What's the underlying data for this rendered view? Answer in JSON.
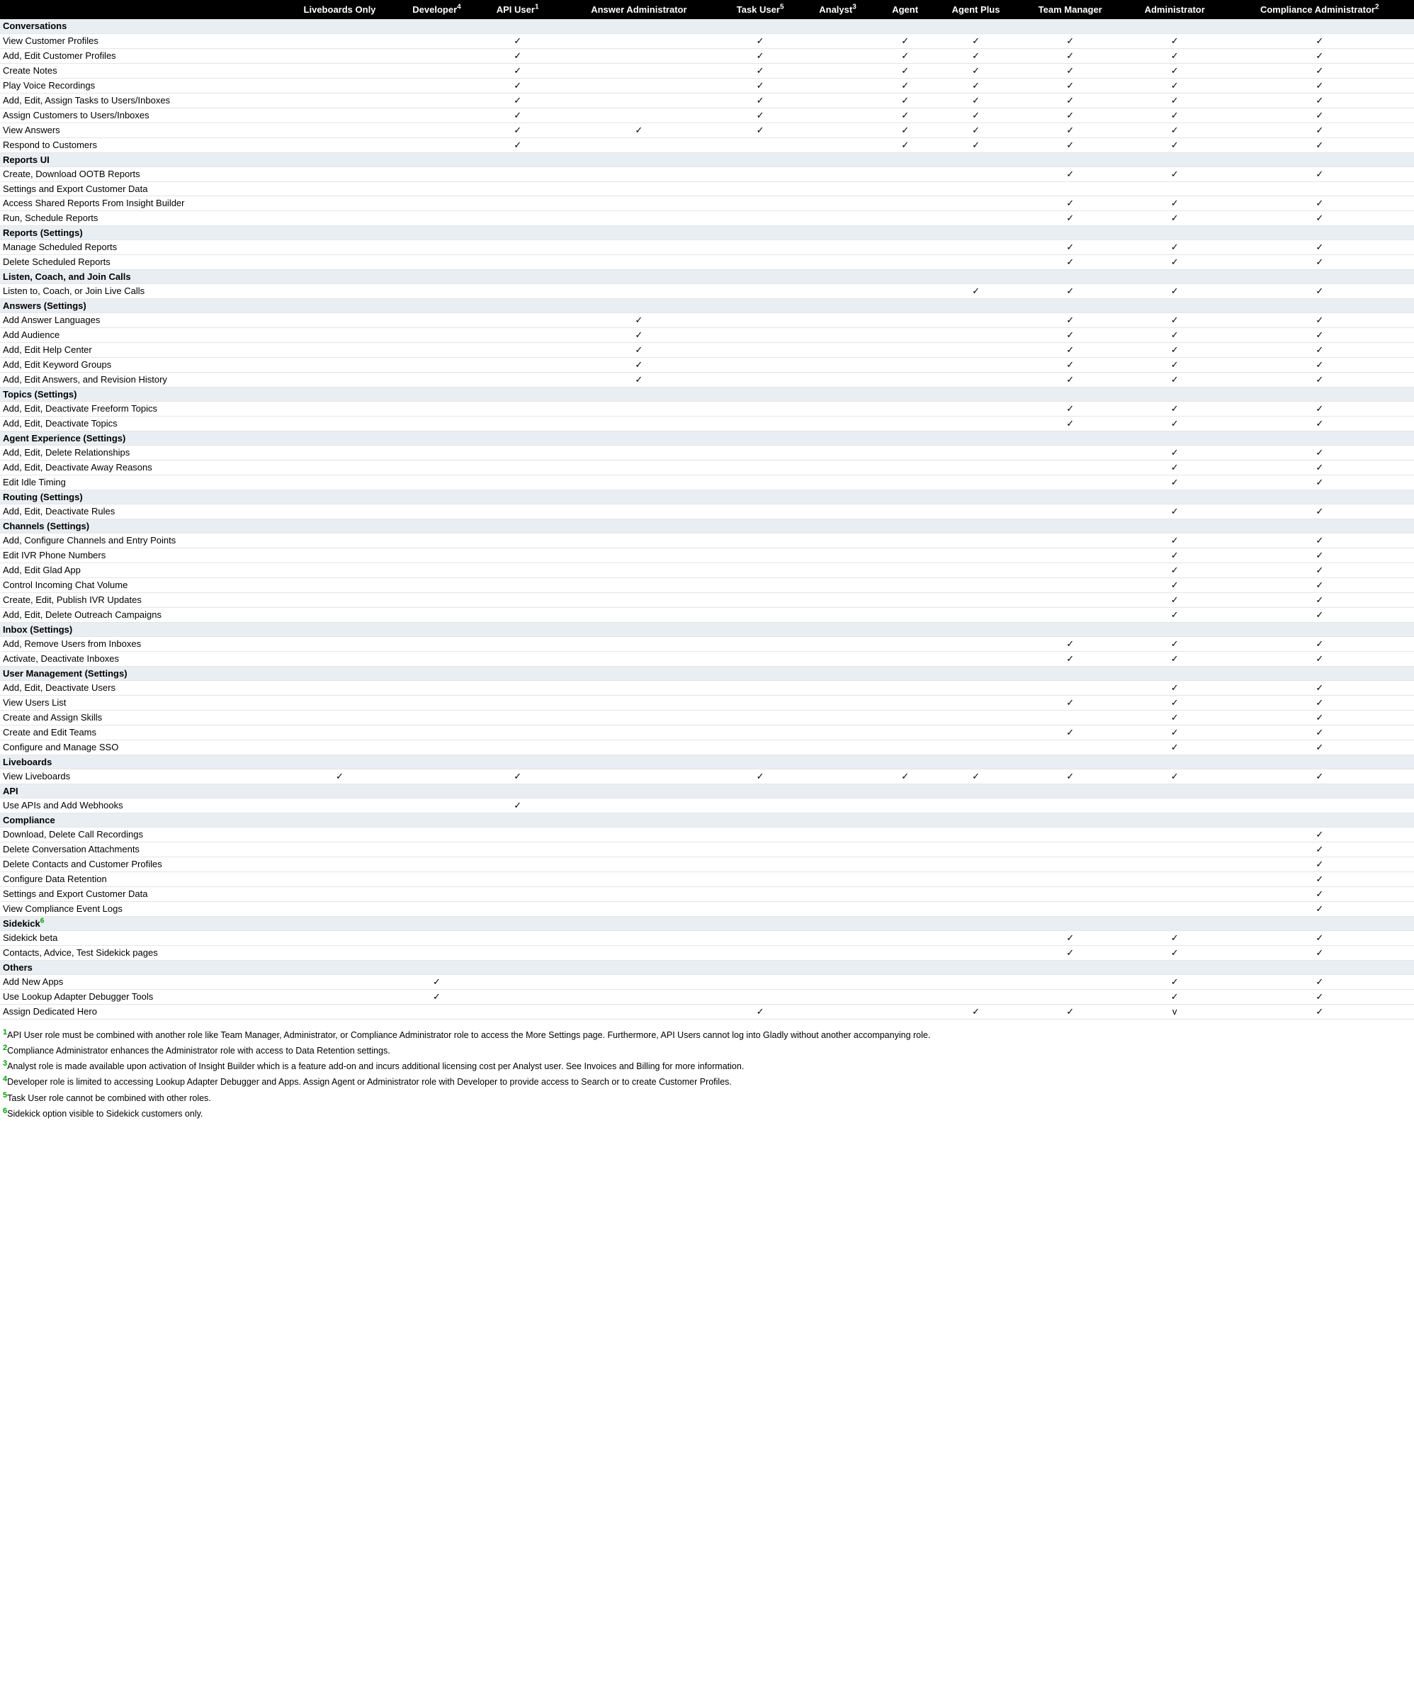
{
  "columns": [
    {
      "label": "Liveboards Only",
      "sup": ""
    },
    {
      "label": "Developer",
      "sup": "4"
    },
    {
      "label": "API User",
      "sup": "1"
    },
    {
      "label": "Answer Administrator",
      "sup": ""
    },
    {
      "label": "Task User",
      "sup": "5"
    },
    {
      "label": "Analyst",
      "sup": "3"
    },
    {
      "label": "Agent",
      "sup": ""
    },
    {
      "label": "Agent Plus",
      "sup": ""
    },
    {
      "label": "Team Manager",
      "sup": ""
    },
    {
      "label": "Administrator",
      "sup": ""
    },
    {
      "label": "Compliance Administrator",
      "sup": "2"
    }
  ],
  "sections": [
    {
      "title": "Conversations",
      "rows": [
        {
          "label": "View Customer Profiles",
          "checks": [
            "",
            "",
            "✓",
            "",
            "✓",
            "",
            "✓",
            "✓",
            "✓",
            "✓",
            "✓"
          ]
        },
        {
          "label": "Add, Edit Customer Profiles",
          "checks": [
            "",
            "",
            "✓",
            "",
            "✓",
            "",
            "✓",
            "✓",
            "✓",
            "✓",
            "✓"
          ]
        },
        {
          "label": "Create Notes",
          "checks": [
            "",
            "",
            "✓",
            "",
            "✓",
            "",
            "✓",
            "✓",
            "✓",
            "✓",
            "✓"
          ]
        },
        {
          "label": "Play Voice Recordings",
          "checks": [
            "",
            "",
            "✓",
            "",
            "✓",
            "",
            "✓",
            "✓",
            "✓",
            "✓",
            "✓"
          ]
        },
        {
          "label": "Add, Edit, Assign Tasks to Users/Inboxes",
          "checks": [
            "",
            "",
            "✓",
            "",
            "✓",
            "",
            "✓",
            "✓",
            "✓",
            "✓",
            "✓"
          ]
        },
        {
          "label": "Assign Customers to Users/Inboxes",
          "checks": [
            "",
            "",
            "✓",
            "",
            "✓",
            "",
            "✓",
            "✓",
            "✓",
            "✓",
            "✓"
          ]
        },
        {
          "label": "View Answers",
          "checks": [
            "",
            "",
            "✓",
            "✓",
            "✓",
            "",
            "✓",
            "✓",
            "✓",
            "✓",
            "✓"
          ]
        },
        {
          "label": "Respond to Customers",
          "checks": [
            "",
            "",
            "✓",
            "",
            "",
            "",
            "✓",
            "✓",
            "✓",
            "✓",
            "✓"
          ]
        }
      ]
    },
    {
      "title": "Reports UI",
      "rows": [
        {
          "label": "Create, Download OOTB Reports",
          "checks": [
            "",
            "",
            "",
            "",
            "",
            "",
            "",
            "",
            "✓",
            "✓",
            "✓"
          ]
        },
        {
          "label": "Settings and Export Customer Data",
          "checks": [
            "",
            "",
            "",
            "",
            "",
            "",
            "",
            "",
            "",
            "",
            ""
          ]
        },
        {
          "label": "Access Shared Reports From Insight Builder",
          "checks": [
            "",
            "",
            "",
            "",
            "",
            "",
            "",
            "",
            "✓",
            "✓",
            "✓"
          ]
        },
        {
          "label": "Run, Schedule Reports",
          "checks": [
            "",
            "",
            "",
            "",
            "",
            "",
            "",
            "",
            "✓",
            "✓",
            "✓"
          ]
        }
      ]
    },
    {
      "title": "Reports (Settings)",
      "rows": [
        {
          "label": "Manage Scheduled Reports",
          "checks": [
            "",
            "",
            "",
            "",
            "",
            "",
            "",
            "",
            "✓",
            "✓",
            "✓"
          ]
        },
        {
          "label": "Delete Scheduled Reports",
          "checks": [
            "",
            "",
            "",
            "",
            "",
            "",
            "",
            "",
            "✓",
            "✓",
            "✓"
          ]
        }
      ]
    },
    {
      "title": "Listen, Coach, and Join Calls",
      "rows": [
        {
          "label": "Listen to, Coach, or Join Live Calls",
          "checks": [
            "",
            "",
            "",
            "",
            "",
            "",
            "",
            "✓",
            "✓",
            "✓",
            "✓"
          ]
        }
      ]
    },
    {
      "title": "Answers (Settings)",
      "rows": [
        {
          "label": "Add Answer Languages",
          "checks": [
            "",
            "",
            "",
            "✓",
            "",
            "",
            "",
            "",
            "✓",
            "✓",
            "✓"
          ]
        },
        {
          "label": "Add Audience",
          "checks": [
            "",
            "",
            "",
            "✓",
            "",
            "",
            "",
            "",
            "✓",
            "✓",
            "✓"
          ]
        },
        {
          "label": "Add, Edit Help Center",
          "checks": [
            "",
            "",
            "",
            "✓",
            "",
            "",
            "",
            "",
            "✓",
            "✓",
            "✓"
          ]
        },
        {
          "label": "Add, Edit Keyword Groups",
          "checks": [
            "",
            "",
            "",
            "✓",
            "",
            "",
            "",
            "",
            "✓",
            "✓",
            "✓"
          ]
        },
        {
          "label": "Add, Edit Answers, and Revision History",
          "checks": [
            "",
            "",
            "",
            "✓",
            "",
            "",
            "",
            "",
            "✓",
            "✓",
            "✓"
          ]
        }
      ]
    },
    {
      "title": "Topics (Settings)",
      "rows": [
        {
          "label": "Add, Edit, Deactivate Freeform Topics",
          "checks": [
            "",
            "",
            "",
            "",
            "",
            "",
            "",
            "",
            "✓",
            "✓",
            "✓"
          ]
        },
        {
          "label": "Add, Edit, Deactivate Topics",
          "checks": [
            "",
            "",
            "",
            "",
            "",
            "",
            "",
            "",
            "✓",
            "✓",
            "✓"
          ]
        }
      ]
    },
    {
      "title": "Agent Experience (Settings)",
      "rows": [
        {
          "label": "Add, Edit, Delete Relationships",
          "checks": [
            "",
            "",
            "",
            "",
            "",
            "",
            "",
            "",
            "",
            "✓",
            "✓"
          ]
        },
        {
          "label": "Add, Edit, Deactivate Away Reasons",
          "checks": [
            "",
            "",
            "",
            "",
            "",
            "",
            "",
            "",
            "",
            "✓",
            "✓"
          ]
        },
        {
          "label": "Edit Idle Timing",
          "checks": [
            "",
            "",
            "",
            "",
            "",
            "",
            "",
            "",
            "",
            "✓",
            "✓"
          ]
        }
      ]
    },
    {
      "title": "Routing (Settings)",
      "rows": [
        {
          "label": "Add, Edit, Deactivate Rules",
          "checks": [
            "",
            "",
            "",
            "",
            "",
            "",
            "",
            "",
            "",
            "✓",
            "✓"
          ]
        }
      ]
    },
    {
      "title": "Channels (Settings)",
      "rows": [
        {
          "label": "Add, Configure Channels and Entry Points",
          "checks": [
            "",
            "",
            "",
            "",
            "",
            "",
            "",
            "",
            "",
            "✓",
            "✓"
          ]
        },
        {
          "label": "Edit IVR Phone Numbers",
          "checks": [
            "",
            "",
            "",
            "",
            "",
            "",
            "",
            "",
            "",
            "✓",
            "✓"
          ]
        },
        {
          "label": "Add, Edit Glad App",
          "checks": [
            "",
            "",
            "",
            "",
            "",
            "",
            "",
            "",
            "",
            "✓",
            "✓"
          ]
        },
        {
          "label": "Control Incoming Chat Volume",
          "checks": [
            "",
            "",
            "",
            "",
            "",
            "",
            "",
            "",
            "",
            "✓",
            "✓"
          ]
        },
        {
          "label": "Create, Edit, Publish IVR Updates",
          "checks": [
            "",
            "",
            "",
            "",
            "",
            "",
            "",
            "",
            "",
            "✓",
            "✓"
          ]
        },
        {
          "label": "Add, Edit, Delete Outreach Campaigns",
          "checks": [
            "",
            "",
            "",
            "",
            "",
            "",
            "",
            "",
            "",
            "✓",
            "✓"
          ]
        }
      ]
    },
    {
      "title": "Inbox (Settings)",
      "rows": [
        {
          "label": "Add, Remove Users from Inboxes",
          "checks": [
            "",
            "",
            "",
            "",
            "",
            "",
            "",
            "",
            "✓",
            "✓",
            "✓"
          ]
        },
        {
          "label": "Activate, Deactivate Inboxes",
          "checks": [
            "",
            "",
            "",
            "",
            "",
            "",
            "",
            "",
            "✓",
            "✓",
            "✓"
          ]
        }
      ]
    },
    {
      "title": "User Management (Settings)",
      "rows": [
        {
          "label": "Add, Edit, Deactivate Users",
          "checks": [
            "",
            "",
            "",
            "",
            "",
            "",
            "",
            "",
            "",
            "✓",
            "✓"
          ]
        },
        {
          "label": "View Users List",
          "checks": [
            "",
            "",
            "",
            "",
            "",
            "",
            "",
            "",
            "✓",
            "✓",
            "✓"
          ]
        },
        {
          "label": "Create and Assign Skills",
          "checks": [
            "",
            "",
            "",
            "",
            "",
            "",
            "",
            "",
            "",
            "✓",
            "✓"
          ]
        },
        {
          "label": "Create and Edit Teams",
          "checks": [
            "",
            "",
            "",
            "",
            "",
            "",
            "",
            "",
            "✓",
            "✓",
            "✓"
          ]
        },
        {
          "label": "Configure and Manage SSO",
          "checks": [
            "",
            "",
            "",
            "",
            "",
            "",
            "",
            "",
            "",
            "✓",
            "✓"
          ]
        }
      ]
    },
    {
      "title": "Liveboards",
      "rows": [
        {
          "label": "View Liveboards",
          "checks": [
            "✓",
            "",
            "✓",
            "",
            "✓",
            "",
            "✓",
            "✓",
            "✓",
            "✓",
            "✓"
          ]
        }
      ]
    },
    {
      "title": "API",
      "rows": [
        {
          "label": "Use APIs and Add Webhooks",
          "checks": [
            "",
            "",
            "✓",
            "",
            "",
            "",
            "",
            "",
            "",
            "",
            ""
          ]
        }
      ]
    },
    {
      "title": "Compliance",
      "rows": [
        {
          "label": "Download, Delete Call Recordings",
          "checks": [
            "",
            "",
            "",
            "",
            "",
            "",
            "",
            "",
            "",
            "",
            "✓"
          ]
        },
        {
          "label": "Delete Conversation Attachments",
          "checks": [
            "",
            "",
            "",
            "",
            "",
            "",
            "",
            "",
            "",
            "",
            "✓"
          ]
        },
        {
          "label": "Delete Contacts and Customer Profiles",
          "checks": [
            "",
            "",
            "",
            "",
            "",
            "",
            "",
            "",
            "",
            "",
            "✓"
          ]
        },
        {
          "label": "Configure Data Retention",
          "checks": [
            "",
            "",
            "",
            "",
            "",
            "",
            "",
            "",
            "",
            "",
            "✓"
          ]
        },
        {
          "label": "Settings and Export Customer Data",
          "checks": [
            "",
            "",
            "",
            "",
            "",
            "",
            "",
            "",
            "",
            "",
            "✓"
          ]
        },
        {
          "label": "View Compliance Event Logs",
          "checks": [
            "",
            "",
            "",
            "",
            "",
            "",
            "",
            "",
            "",
            "",
            "✓"
          ]
        }
      ]
    },
    {
      "title": "Sidekick",
      "title_sup": "6",
      "rows": [
        {
          "label": "Sidekick beta",
          "checks": [
            "",
            "",
            "",
            "",
            "",
            "",
            "",
            "",
            "✓",
            "✓",
            "✓"
          ]
        },
        {
          "label": "Contacts, Advice, Test Sidekick pages",
          "checks": [
            "",
            "",
            "",
            "",
            "",
            "",
            "",
            "",
            "✓",
            "✓",
            "✓"
          ]
        }
      ]
    },
    {
      "title": "Others",
      "rows": [
        {
          "label": "Add New Apps",
          "checks": [
            "",
            "✓",
            "",
            "",
            "",
            "",
            "",
            "",
            "",
            "✓",
            "✓"
          ]
        },
        {
          "label": "Use Lookup Adapter Debugger Tools",
          "checks": [
            "",
            "✓",
            "",
            "",
            "",
            "",
            "",
            "",
            "",
            "✓",
            "✓"
          ]
        },
        {
          "label": "Assign Dedicated Hero",
          "checks": [
            "",
            "",
            "",
            "",
            "✓",
            "",
            "",
            "✓",
            "✓",
            "v",
            "✓"
          ]
        }
      ]
    }
  ],
  "footnotes": [
    {
      "num": "1",
      "text": "API User role must be combined with another role like Team Manager, Administrator, or Compliance Administrator role to access the More Settings page. Furthermore, API Users cannot log into Gladly without another accompanying role."
    },
    {
      "num": "2",
      "text": "Compliance Administrator enhances the Administrator role with access to Data Retention settings."
    },
    {
      "num": "3",
      "text": "Analyst role is made available upon activation of Insight Builder which is a feature add-on and incurs additional licensing cost per Analyst user. See Invoices and Billing for more information."
    },
    {
      "num": "4",
      "text": "Developer role is limited to accessing Lookup Adapter Debugger and Apps. Assign Agent or Administrator role with Developer to provide access to Search or to create Customer Profiles."
    },
    {
      "num": "5",
      "text": "Task User role cannot be combined with other roles."
    },
    {
      "num": "6",
      "text": "Sidekick option visible to Sidekick customers only."
    }
  ]
}
